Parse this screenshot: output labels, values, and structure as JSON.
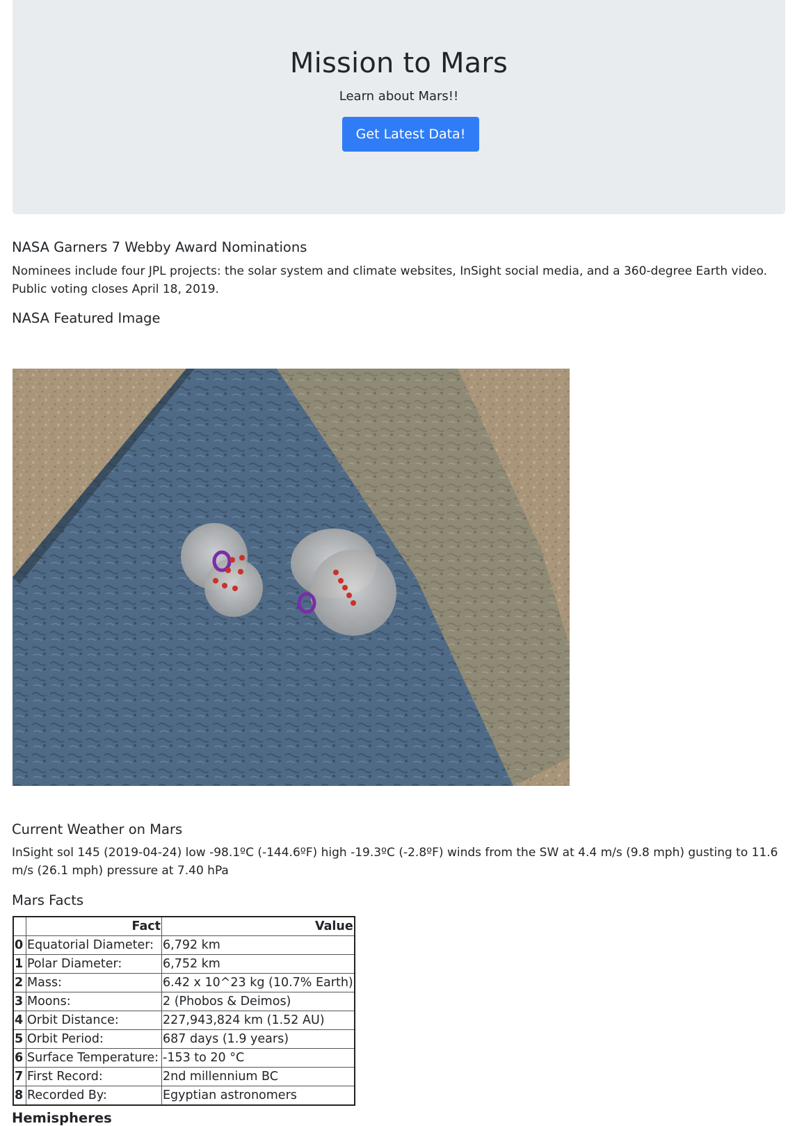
{
  "header": {
    "title": "Mission to Mars",
    "subtitle": "Learn about Mars!!",
    "button_label": "Get Latest Data!"
  },
  "news": {
    "title": "NASA Garners 7 Webby Award Nominations",
    "paragraph": "Nominees include four JPL projects: the solar system and climate websites, InSight social media, and a 360-degree Earth video. Public voting closes April 18, 2019."
  },
  "featured": {
    "title": "NASA Featured Image"
  },
  "weather": {
    "title": "Current Weather on Mars",
    "text": "InSight sol 145 (2019-04-24) low -98.1ºC (-144.6ºF) high -19.3ºC (-2.8ºF) winds from the SW at 4.4 m/s (9.8 mph) gusting to 11.6 m/s (26.1 mph) pressure at 7.40 hPa"
  },
  "facts": {
    "title": "Mars Facts",
    "headers": [
      "",
      "Fact",
      "Value"
    ],
    "rows": [
      {
        "index": "0",
        "fact": "Equatorial Diameter:",
        "value": "6,792 km"
      },
      {
        "index": "1",
        "fact": "Polar Diameter:",
        "value": "6,752 km"
      },
      {
        "index": "2",
        "fact": "Mass:",
        "value": "6.42 x 10^23 kg (10.7% Earth)"
      },
      {
        "index": "3",
        "fact": "Moons:",
        "value": "2 (Phobos & Deimos)"
      },
      {
        "index": "4",
        "fact": "Orbit Distance:",
        "value": "227,943,824 km (1.52 AU)"
      },
      {
        "index": "5",
        "fact": "Orbit Period:",
        "value": "687 days (1.9 years)"
      },
      {
        "index": "6",
        "fact": "Surface Temperature:",
        "value": "-153 to 20 °C"
      },
      {
        "index": "7",
        "fact": "First Record:",
        "value": "2nd millennium BC"
      },
      {
        "index": "8",
        "fact": "Recorded By:",
        "value": "Egyptian astronomers"
      }
    ]
  },
  "hemispheres": {
    "title": "Hemispheres"
  }
}
